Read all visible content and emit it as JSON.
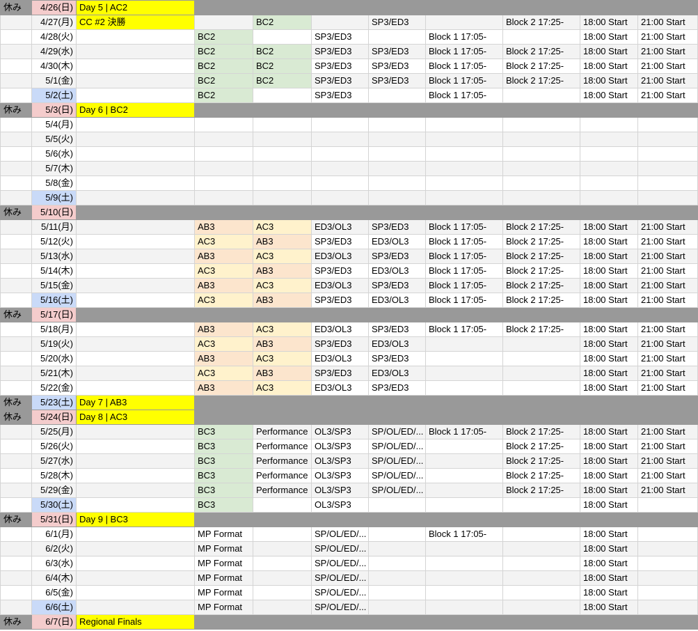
{
  "sheet": {
    "rows": [
      {
        "rest": "休み",
        "date": "4/26(日)",
        "day": "sun",
        "event": "Day 5 | AC2",
        "off": true,
        "c": [
          "",
          "",
          "",
          "",
          "",
          "",
          "",
          ""
        ]
      },
      {
        "rest": "",
        "date": "4/27(月)",
        "day": "",
        "event": "CC #2 決勝",
        "off": false,
        "c": [
          "",
          "BC2",
          "",
          "SP3/ED3",
          "",
          "Block 2 17:25-",
          "18:00 Start",
          "21:00 Start"
        ]
      },
      {
        "rest": "",
        "date": "4/28(火)",
        "day": "",
        "event": "",
        "off": false,
        "c": [
          "BC2",
          "",
          "SP3/ED3",
          "",
          "Block 1 17:05-",
          "",
          "18:00 Start",
          "21:00 Start"
        ]
      },
      {
        "rest": "",
        "date": "4/29(水)",
        "day": "",
        "event": "",
        "off": false,
        "c": [
          "BC2",
          "BC2",
          "SP3/ED3",
          "SP3/ED3",
          "Block 1 17:05-",
          "Block 2 17:25-",
          "18:00 Start",
          "21:00 Start"
        ]
      },
      {
        "rest": "",
        "date": "4/30(木)",
        "day": "",
        "event": "",
        "off": false,
        "c": [
          "BC2",
          "BC2",
          "SP3/ED3",
          "SP3/ED3",
          "Block 1 17:05-",
          "Block 2 17:25-",
          "18:00 Start",
          "21:00 Start"
        ]
      },
      {
        "rest": "",
        "date": "5/1(金)",
        "day": "",
        "event": "",
        "off": false,
        "c": [
          "BC2",
          "BC2",
          "SP3/ED3",
          "SP3/ED3",
          "Block 1 17:05-",
          "Block 2 17:25-",
          "18:00 Start",
          "21:00 Start"
        ]
      },
      {
        "rest": "",
        "date": "5/2(土)",
        "day": "sat",
        "event": "",
        "off": false,
        "c": [
          "BC2",
          "",
          "SP3/ED3",
          "",
          "Block 1 17:05-",
          "",
          "18:00 Start",
          "21:00 Start"
        ]
      },
      {
        "rest": "休み",
        "date": "5/3(日)",
        "day": "sun",
        "event": "Day 6 | BC2",
        "off": true,
        "c": [
          "",
          "",
          "",
          "",
          "",
          "",
          "",
          ""
        ]
      },
      {
        "rest": "",
        "date": "5/4(月)",
        "day": "",
        "event": "",
        "off": false,
        "c": [
          "",
          "",
          "",
          "",
          "",
          "",
          "",
          ""
        ]
      },
      {
        "rest": "",
        "date": "5/5(火)",
        "day": "",
        "event": "",
        "off": false,
        "c": [
          "",
          "",
          "",
          "",
          "",
          "",
          "",
          ""
        ]
      },
      {
        "rest": "",
        "date": "5/6(水)",
        "day": "",
        "event": "",
        "off": false,
        "c": [
          "",
          "",
          "",
          "",
          "",
          "",
          "",
          ""
        ]
      },
      {
        "rest": "",
        "date": "5/7(木)",
        "day": "",
        "event": "",
        "off": false,
        "c": [
          "",
          "",
          "",
          "",
          "",
          "",
          "",
          ""
        ]
      },
      {
        "rest": "",
        "date": "5/8(金)",
        "day": "",
        "event": "",
        "off": false,
        "c": [
          "",
          "",
          "",
          "",
          "",
          "",
          "",
          ""
        ]
      },
      {
        "rest": "",
        "date": "5/9(土)",
        "day": "sat",
        "event": "",
        "off": false,
        "c": [
          "",
          "",
          "",
          "",
          "",
          "",
          "",
          ""
        ]
      },
      {
        "rest": "休み",
        "date": "5/10(日)",
        "day": "sun",
        "event": "",
        "off": true,
        "c": [
          "",
          "",
          "",
          "",
          "",
          "",
          "",
          ""
        ]
      },
      {
        "rest": "",
        "date": "5/11(月)",
        "day": "",
        "event": "",
        "off": false,
        "c": [
          "AB3",
          "AC3",
          "ED3/OL3",
          "SP3/ED3",
          "Block 1 17:05-",
          "Block 2 17:25-",
          "18:00 Start",
          "21:00 Start"
        ]
      },
      {
        "rest": "",
        "date": "5/12(火)",
        "day": "",
        "event": "",
        "off": false,
        "c": [
          "AC3",
          "AB3",
          "SP3/ED3",
          "ED3/OL3",
          "Block 1 17:05-",
          "Block 2 17:25-",
          "18:00 Start",
          "21:00 Start"
        ]
      },
      {
        "rest": "",
        "date": "5/13(水)",
        "day": "",
        "event": "",
        "off": false,
        "c": [
          "AB3",
          "AC3",
          "ED3/OL3",
          "SP3/ED3",
          "Block 1 17:05-",
          "Block 2 17:25-",
          "18:00 Start",
          "21:00 Start"
        ]
      },
      {
        "rest": "",
        "date": "5/14(木)",
        "day": "",
        "event": "",
        "off": false,
        "c": [
          "AC3",
          "AB3",
          "SP3/ED3",
          "ED3/OL3",
          "Block 1 17:05-",
          "Block 2 17:25-",
          "18:00 Start",
          "21:00 Start"
        ]
      },
      {
        "rest": "",
        "date": "5/15(金)",
        "day": "",
        "event": "",
        "off": false,
        "c": [
          "AB3",
          "AC3",
          "ED3/OL3",
          "SP3/ED3",
          "Block 1 17:05-",
          "Block 2 17:25-",
          "18:00 Start",
          "21:00 Start"
        ]
      },
      {
        "rest": "",
        "date": "5/16(土)",
        "day": "sat",
        "event": "",
        "off": false,
        "c": [
          "AC3",
          "AB3",
          "SP3/ED3",
          "ED3/OL3",
          "Block 1 17:05-",
          "Block 2 17:25-",
          "18:00 Start",
          "21:00 Start"
        ]
      },
      {
        "rest": "休み",
        "date": "5/17(日)",
        "day": "sun",
        "event": "",
        "off": true,
        "c": [
          "",
          "",
          "",
          "",
          "",
          "",
          "",
          ""
        ]
      },
      {
        "rest": "",
        "date": "5/18(月)",
        "day": "",
        "event": "",
        "off": false,
        "c": [
          "AB3",
          "AC3",
          "ED3/OL3",
          "SP3/ED3",
          "Block 1 17:05-",
          "Block 2 17:25-",
          "18:00 Start",
          "21:00 Start"
        ]
      },
      {
        "rest": "",
        "date": "5/19(火)",
        "day": "",
        "event": "",
        "off": false,
        "c": [
          "AC3",
          "AB3",
          "SP3/ED3",
          "ED3/OL3",
          "",
          "",
          "18:00 Start",
          "21:00 Start"
        ]
      },
      {
        "rest": "",
        "date": "5/20(水)",
        "day": "",
        "event": "",
        "off": false,
        "c": [
          "AB3",
          "AC3",
          "ED3/OL3",
          "SP3/ED3",
          "",
          "",
          "18:00 Start",
          "21:00 Start"
        ]
      },
      {
        "rest": "",
        "date": "5/21(木)",
        "day": "",
        "event": "",
        "off": false,
        "c": [
          "AC3",
          "AB3",
          "SP3/ED3",
          "ED3/OL3",
          "",
          "",
          "18:00 Start",
          "21:00 Start"
        ]
      },
      {
        "rest": "",
        "date": "5/22(金)",
        "day": "",
        "event": "",
        "off": false,
        "c": [
          "AB3",
          "AC3",
          "ED3/OL3",
          "SP3/ED3",
          "",
          "",
          "18:00 Start",
          "21:00 Start"
        ]
      },
      {
        "rest": "休み",
        "date": "5/23(土)",
        "day": "sat",
        "event": "Day 7 | AB3",
        "off": true,
        "c": [
          "",
          "",
          "",
          "",
          "",
          "",
          "",
          ""
        ]
      },
      {
        "rest": "休み",
        "date": "5/24(日)",
        "day": "sun",
        "event": "Day 8 | AC3",
        "off": true,
        "c": [
          "",
          "",
          "",
          "",
          "",
          "",
          "",
          ""
        ]
      },
      {
        "rest": "",
        "date": "5/25(月)",
        "day": "",
        "event": "",
        "off": false,
        "c": [
          "BC3",
          "Performance",
          "OL3/SP3",
          "SP/OL/ED/...",
          "Block 1 17:05-",
          "Block 2 17:25-",
          "18:00 Start",
          "21:00 Start"
        ]
      },
      {
        "rest": "",
        "date": "5/26(火)",
        "day": "",
        "event": "",
        "off": false,
        "c": [
          "BC3",
          "Performance",
          "OL3/SP3",
          "SP/OL/ED/...",
          "",
          "Block 2 17:25-",
          "18:00 Start",
          "21:00 Start"
        ]
      },
      {
        "rest": "",
        "date": "5/27(水)",
        "day": "",
        "event": "",
        "off": false,
        "c": [
          "BC3",
          "Performance",
          "OL3/SP3",
          "SP/OL/ED/...",
          "",
          "Block 2 17:25-",
          "18:00 Start",
          "21:00 Start"
        ]
      },
      {
        "rest": "",
        "date": "5/28(木)",
        "day": "",
        "event": "",
        "off": false,
        "c": [
          "BC3",
          "Performance",
          "OL3/SP3",
          "SP/OL/ED/...",
          "",
          "Block 2 17:25-",
          "18:00 Start",
          "21:00 Start"
        ]
      },
      {
        "rest": "",
        "date": "5/29(金)",
        "day": "",
        "event": "",
        "off": false,
        "c": [
          "BC3",
          "Performance",
          "OL3/SP3",
          "SP/OL/ED/...",
          "",
          "Block 2 17:25-",
          "18:00 Start",
          "21:00 Start"
        ]
      },
      {
        "rest": "",
        "date": "5/30(土)",
        "day": "sat",
        "event": "",
        "off": false,
        "c": [
          "BC3",
          "",
          "OL3/SP3",
          "",
          "",
          "",
          "18:00 Start",
          ""
        ]
      },
      {
        "rest": "休み",
        "date": "5/31(日)",
        "day": "sun",
        "event": "Day 9 | BC3",
        "off": true,
        "c": [
          "",
          "",
          "",
          "",
          "",
          "",
          "",
          ""
        ]
      },
      {
        "rest": "",
        "date": "6/1(月)",
        "day": "",
        "event": "",
        "off": false,
        "c": [
          "MP Format",
          "",
          "SP/OL/ED/...",
          "",
          "Block 1 17:05-",
          "",
          "18:00 Start",
          ""
        ]
      },
      {
        "rest": "",
        "date": "6/2(火)",
        "day": "",
        "event": "",
        "off": false,
        "c": [
          "MP Format",
          "",
          "SP/OL/ED/...",
          "",
          "",
          "",
          "18:00 Start",
          ""
        ]
      },
      {
        "rest": "",
        "date": "6/3(水)",
        "day": "",
        "event": "",
        "off": false,
        "c": [
          "MP Format",
          "",
          "SP/OL/ED/...",
          "",
          "",
          "",
          "18:00 Start",
          ""
        ]
      },
      {
        "rest": "",
        "date": "6/4(木)",
        "day": "",
        "event": "",
        "off": false,
        "c": [
          "MP Format",
          "",
          "SP/OL/ED/...",
          "",
          "",
          "",
          "18:00 Start",
          ""
        ]
      },
      {
        "rest": "",
        "date": "6/5(金)",
        "day": "",
        "event": "",
        "off": false,
        "c": [
          "MP Format",
          "",
          "SP/OL/ED/...",
          "",
          "",
          "",
          "18:00 Start",
          ""
        ]
      },
      {
        "rest": "",
        "date": "6/6(土)",
        "day": "sat",
        "event": "",
        "off": false,
        "c": [
          "MP Format",
          "",
          "SP/OL/ED/...",
          "",
          "",
          "",
          "18:00 Start",
          ""
        ]
      },
      {
        "rest": "休み",
        "date": "6/7(日)",
        "day": "sun",
        "event": "Regional Finals",
        "off": true,
        "c": [
          "",
          "",
          "",
          "",
          "",
          "",
          "",
          ""
        ]
      }
    ]
  }
}
